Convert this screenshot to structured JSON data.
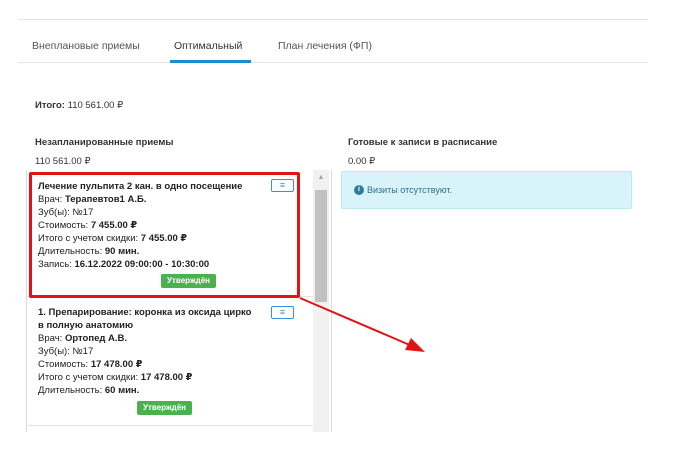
{
  "tabs": [
    {
      "label": "Внеплановые приемы"
    },
    {
      "label": "Оптимальный"
    },
    {
      "label": "План лечения (ФП)"
    }
  ],
  "active_tab": "Оптимальный",
  "total": {
    "label": "Итого:",
    "value": "110 561.00 ₽"
  },
  "unplanned": {
    "title": "Незапланированные приемы",
    "sum": "110 561.00 ₽",
    "cards": [
      {
        "name": "Лечение пульпита 2 кан. в одно посещение",
        "doctor_label": "Врач:",
        "doctor": "Терапевтов1 А.Б.",
        "teeth_label": "Зуб(ы):",
        "teeth": "№17",
        "cost_label": "Стоимость:",
        "cost": "7 455.00 ₽",
        "discount_label": "Итого с учетом скидки:",
        "discount": "7 455.00 ₽",
        "duration_label": "Длительность:",
        "duration": "90 мин.",
        "record_label": "Запись:",
        "record": "16.12.2022 09:00:00 - 10:30:00",
        "status": "Утверждён"
      },
      {
        "name_line1": "1. Препарирование: коронка из оксида цирко",
        "name_line2": "в полную анатомию",
        "doctor_label": "Врач:",
        "doctor": "Ортопед А.В.",
        "teeth_label": "Зуб(ы):",
        "teeth": "№17",
        "cost_label": "Стоимость:",
        "cost": "17 478.00 ₽",
        "discount_label": "Итого с учетом скидки:",
        "discount": "17 478.00 ₽",
        "duration_label": "Длительность:",
        "duration": "60 мин.",
        "status": "Утверждён"
      }
    ]
  },
  "ready": {
    "title": "Готовые к записи в расписание",
    "sum": "0.00 ₽",
    "info_text": "Визиты отсутствуют."
  },
  "icons": {
    "menu": "hamburger-icon",
    "info": "info-circle-icon",
    "scroll_up": "triangle-up-icon"
  },
  "colors": {
    "accent": "#1a8fd0",
    "status_green": "#4caf50",
    "highlight_red": "#e01414",
    "info_bg": "#d9f3fb"
  }
}
